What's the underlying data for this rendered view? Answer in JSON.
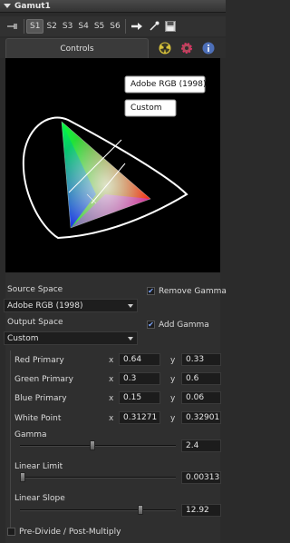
{
  "title": "Gamut1",
  "version_bar": {
    "versions": [
      "S1",
      "S2",
      "S3",
      "S4",
      "S5",
      "S6"
    ],
    "active_version": "S1"
  },
  "tabs": {
    "controls_label": "Controls"
  },
  "gamut_view": {
    "source_label": "Adobe RGB (1998)",
    "output_label": "Custom"
  },
  "source_space": {
    "label": "Source Space",
    "value": "Adobe RGB (1998)"
  },
  "remove_gamma": {
    "label": "Remove Gamma",
    "checked": true
  },
  "output_space": {
    "label": "Output Space",
    "value": "Custom"
  },
  "add_gamma": {
    "label": "Add Gamma",
    "checked": true
  },
  "primaries": [
    {
      "label": "Red Primary",
      "x": "0.64",
      "y": "0.33"
    },
    {
      "label": "Green Primary",
      "x": "0.3",
      "y": "0.6"
    },
    {
      "label": "Blue Primary",
      "x": "0.15",
      "y": "0.06"
    },
    {
      "label": "White Point",
      "x": "0.31271",
      "y": "0.32901"
    }
  ],
  "axis_labels": {
    "x": "x",
    "y": "y"
  },
  "sliders": {
    "gamma": {
      "label": "Gamma",
      "value": "2.4"
    },
    "linear_limit": {
      "label": "Linear Limit",
      "value": "0.00313"
    },
    "linear_slope": {
      "label": "Linear Slope",
      "value": "12.92"
    }
  },
  "pre_divide": {
    "label": "Pre-Divide / Post-Multiply",
    "checked": false
  },
  "colors": {
    "panel_bg": "#2f2f2f",
    "field_bg": "#1c1c1c",
    "check_mark": "#7fa8ff"
  }
}
